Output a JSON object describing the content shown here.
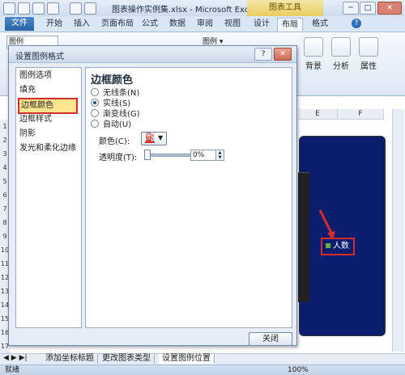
{
  "window": {
    "title": "图表操作实例集.xlsx - Microsoft Excel",
    "chart_tools_label": "图表工具",
    "controls": [
      "─",
      "□",
      "✕"
    ]
  },
  "ribbon_tabs": [
    {
      "label": "文件"
    },
    {
      "label": "开始"
    },
    {
      "label": "插入"
    },
    {
      "label": "页面布局"
    },
    {
      "label": "公式"
    },
    {
      "label": "数据"
    },
    {
      "label": "审阅"
    },
    {
      "label": "视图"
    },
    {
      "label": "设计"
    },
    {
      "label": "布局"
    },
    {
      "label": "格式"
    }
  ],
  "ribbon": {
    "name_box": "图例",
    "group_labels": [
      "背景",
      "分析",
      "属性"
    ],
    "chart_elem_label": "图例 ▾"
  },
  "sheet": {
    "columns": [
      "E",
      "F"
    ],
    "rows": [
      "1",
      "2",
      "3",
      "4",
      "5",
      "6",
      "7",
      "8",
      "9",
      "10",
      "11",
      "12",
      "13",
      "14",
      "15",
      "16",
      "17"
    ]
  },
  "chart": {
    "legend_text": "人数",
    "legend_color": "#6fae3c"
  },
  "dialog": {
    "title": "设置图例格式",
    "categories": [
      {
        "label": "图例选项"
      },
      {
        "label": "填充"
      },
      {
        "label": "边框颜色",
        "selected": true
      },
      {
        "label": "边框样式"
      },
      {
        "label": "阴影"
      },
      {
        "label": "发光和柔化边缘"
      }
    ],
    "heading": "边框颜色",
    "options": [
      {
        "label": "无线条(N)",
        "checked": false
      },
      {
        "label": "实线(S)",
        "checked": true
      },
      {
        "label": "渐变线(G)",
        "checked": false
      },
      {
        "label": "自动(U)",
        "checked": false
      }
    ],
    "color_label": "颜色(C):",
    "transparency_label": "透明度(T):",
    "transparency_value": "0%",
    "close_button": "关闭"
  },
  "sheet_tabs": [
    {
      "label": "添加坐标标题"
    },
    {
      "label": "更改图表类型"
    },
    {
      "label": "设置图例位置",
      "active": true
    }
  ],
  "status": {
    "ready": "就绪",
    "zoom": "100%"
  }
}
